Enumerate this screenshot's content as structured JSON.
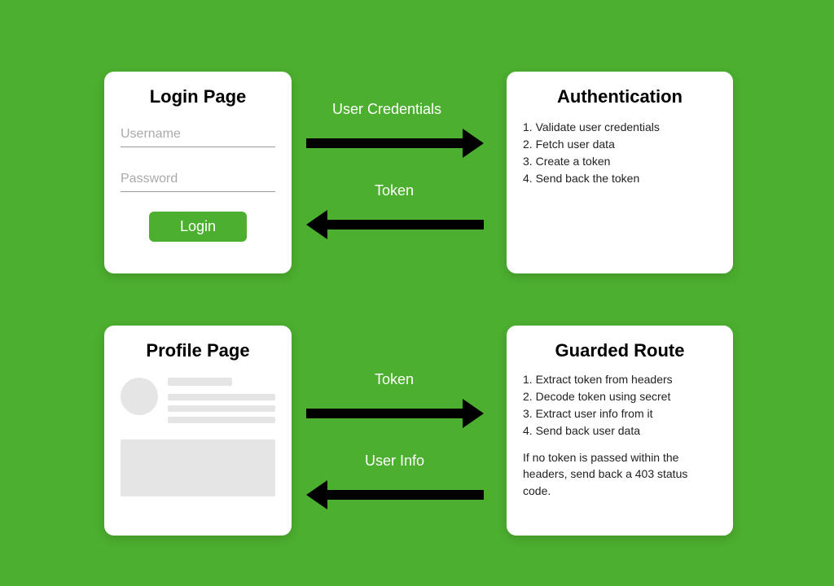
{
  "login": {
    "title": "Login Page",
    "username_placeholder": "Username",
    "password_placeholder": "Password",
    "button_label": "Login"
  },
  "auth": {
    "title": "Authentication",
    "steps": [
      "Validate user credentials",
      "Fetch user data",
      "Create a token",
      "Send back the token"
    ]
  },
  "profile": {
    "title": "Profile Page"
  },
  "guarded": {
    "title": "Guarded Route",
    "steps": [
      "Extract token from headers",
      "Decode token using secret",
      "Extract user info from it",
      "Send back user data"
    ],
    "note": "If no token is passed within the headers, send back a 403 status code."
  },
  "arrows": {
    "a1": "User Credentials",
    "a2": "Token",
    "a3": "Token",
    "a4": "User Info"
  }
}
